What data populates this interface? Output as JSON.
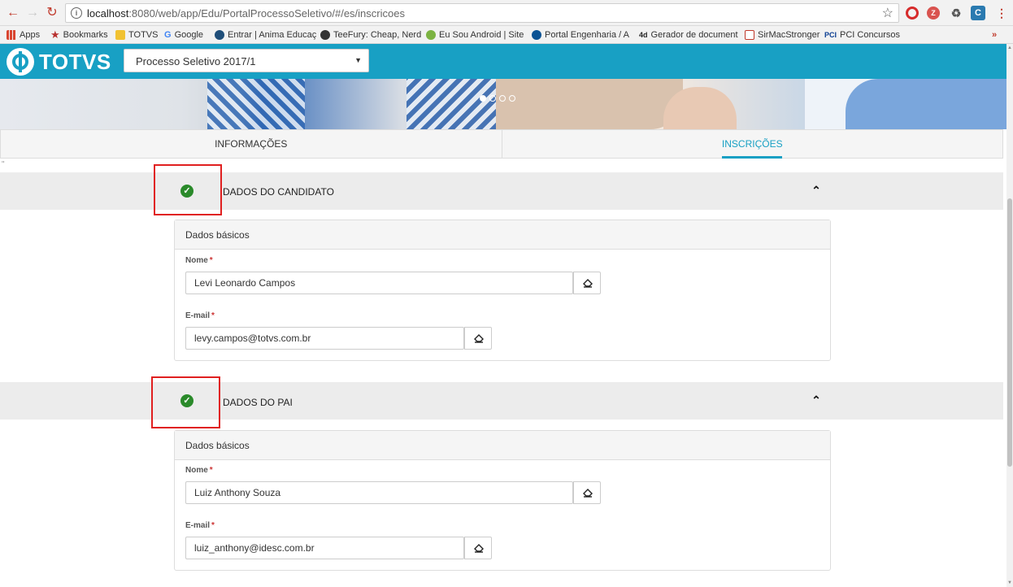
{
  "browser": {
    "url_host": "localhost",
    "url_rest": ":8080/web/app/Edu/PortalProcessoSeletivo/#/es/inscricoes",
    "bookmarks": [
      {
        "label": "Apps",
        "icon": "apps-grid-icon",
        "color": "#d9442f"
      },
      {
        "label": "Bookmarks",
        "icon": "star-icon",
        "color": "#b8312f"
      },
      {
        "label": "TOTVS",
        "icon": "folder-icon",
        "color": "#f1c232"
      },
      {
        "label": "Google",
        "icon": "google-icon",
        "color": "#4285f4"
      },
      {
        "label": "Entrar | Anima Educaç",
        "icon": "anima-icon",
        "color": "#1f4e79"
      },
      {
        "label": "TeeFury: Cheap, Nerd",
        "icon": "teefury-icon",
        "color": "#333333"
      },
      {
        "label": "Eu Sou Android | Site",
        "icon": "android-icon",
        "color": "#7cb342"
      },
      {
        "label": "Portal Engenharia / A",
        "icon": "portal-icon",
        "color": "#0b5394"
      },
      {
        "label": "Gerador de document",
        "icon": "4devs-icon",
        "color": "#222222"
      },
      {
        "label": "SirMacStronger",
        "icon": "doc-icon",
        "color": "#c0392b"
      },
      {
        "label": "PCI Concursos",
        "icon": "pci-icon",
        "color": "#0b3d91"
      }
    ],
    "more_bookmarks": "»"
  },
  "app": {
    "logo_text": "TOTVS",
    "process_select": "Processo Seletivo 2017/1",
    "brand_color": "#18a0c4"
  },
  "tabs": [
    {
      "label": "INFORMAÇÕES",
      "active": false
    },
    {
      "label": "INSCRIÇÕES",
      "active": true
    }
  ],
  "stray_mark": "\"",
  "sections": [
    {
      "title": "DADOS DO CANDIDATO",
      "card_title": "Dados básicos",
      "name_label": "Nome",
      "name_value": "Levi Leonardo Campos",
      "email_label": "E-mail",
      "email_value": "levy.campos@totvs.com.br"
    },
    {
      "title": "DADOS DO PAI",
      "card_title": "Dados básicos",
      "name_label": "Nome",
      "name_value": "Luiz Anthony Souza",
      "email_label": "E-mail",
      "email_value": "luiz_anthony@idesc.com.br"
    }
  ],
  "required_marker": "*"
}
